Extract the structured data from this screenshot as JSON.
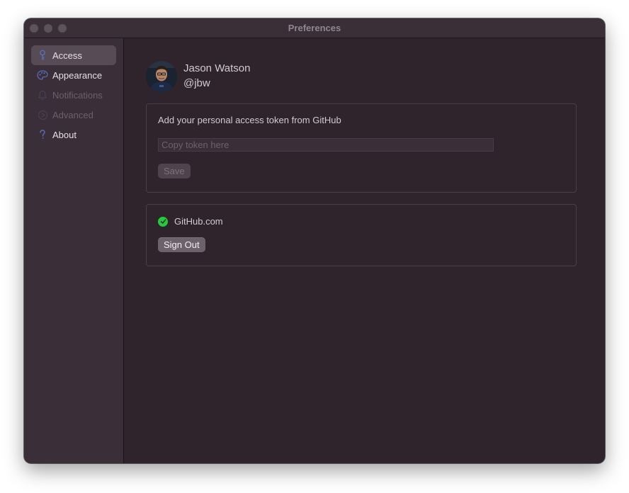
{
  "window": {
    "title": "Preferences"
  },
  "sidebar": {
    "items": [
      {
        "label": "Access",
        "icon": "key-icon",
        "active": true
      },
      {
        "label": "Appearance",
        "icon": "palette-icon",
        "active": false
      },
      {
        "label": "Notifications",
        "icon": "bell-icon",
        "active": false
      },
      {
        "label": "Advanced",
        "icon": "advanced-icon",
        "active": false
      },
      {
        "label": "About",
        "icon": "question-mark-icon",
        "active": false
      }
    ]
  },
  "profile": {
    "name": "Jason Watson",
    "handle": "@jbw"
  },
  "token_section": {
    "heading": "Add your personal access token from GitHub",
    "input_value": "",
    "input_placeholder": "Copy token here",
    "save_label": "Save"
  },
  "status_section": {
    "host": "GitHub.com",
    "status_icon": "check-circle-icon",
    "sign_out_label": "Sign Out"
  },
  "colors": {
    "window_bg": "#2f232c",
    "sidebar_bg": "#3a2e38",
    "sidebar_active": "#574b55",
    "accent_icon": "#5b6eb8",
    "status_ok": "#27c93f"
  }
}
